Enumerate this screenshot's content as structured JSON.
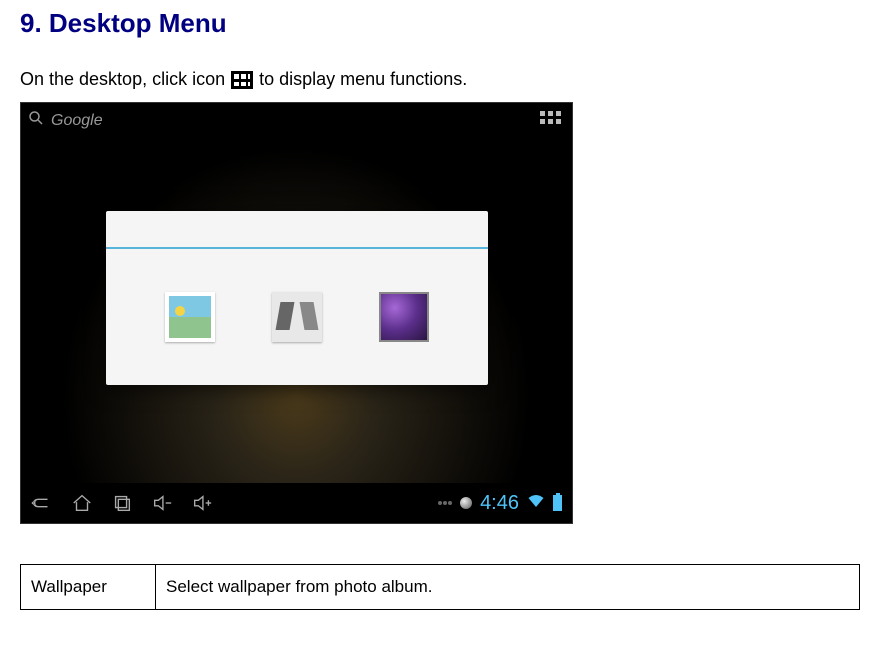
{
  "heading": "9. Desktop Menu",
  "intro_before": "On the desktop, click icon",
  "intro_after": "to display menu functions.",
  "screenshot": {
    "search_label": "Google",
    "status_time": "4:46"
  },
  "table": {
    "rows": [
      {
        "label": "Wallpaper",
        "desc": "Select wallpaper from photo album."
      }
    ]
  }
}
